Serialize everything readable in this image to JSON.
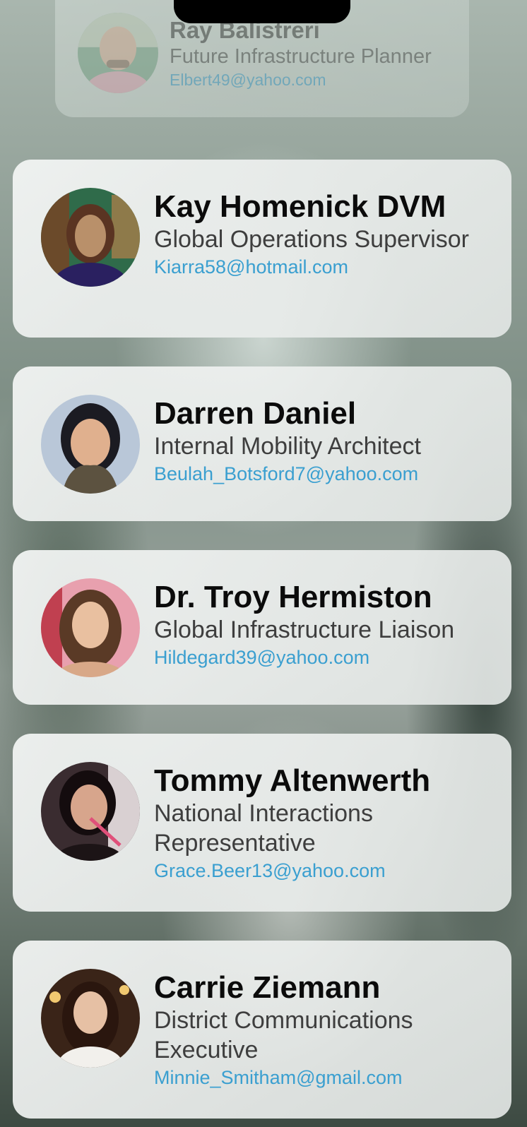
{
  "contacts": [
    {
      "name": "Ray Balistreri",
      "title": "Future Infrastructure Planner",
      "email": "Elbert49@yahoo.com"
    },
    {
      "name": "Kay Homenick DVM",
      "title": "Global Operations Supervisor",
      "email": "Kiarra58@hotmail.com"
    },
    {
      "name": "Darren Daniel",
      "title": "Internal Mobility Architect",
      "email": "Beulah_Botsford7@yahoo.com"
    },
    {
      "name": "Dr. Troy Hermiston",
      "title": "Global Infrastructure Liaison",
      "email": "Hildegard39@yahoo.com"
    },
    {
      "name": "Tommy Altenwerth",
      "title": "National Interactions Representative",
      "email": "Grace.Beer13@yahoo.com"
    },
    {
      "name": "Carrie Ziemann",
      "title": "District Communications Executive",
      "email": "Minnie_Smitham@gmail.com"
    }
  ]
}
